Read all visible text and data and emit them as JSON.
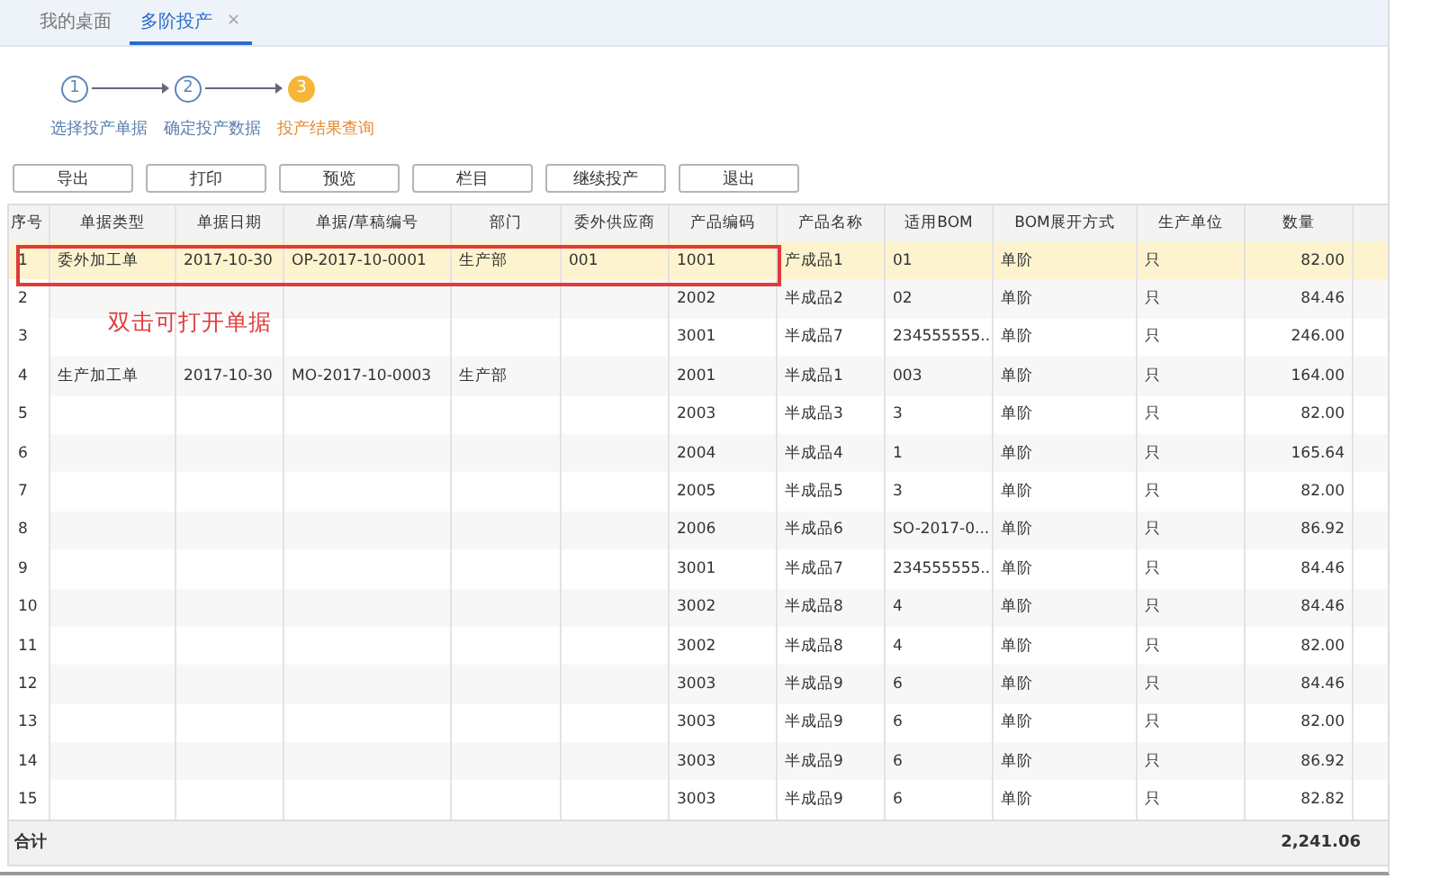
{
  "tabs": [
    {
      "label": "我的桌面",
      "selected": false
    },
    {
      "label": "多阶投产",
      "selected": true,
      "close": "✕"
    }
  ],
  "steps": [
    {
      "number": "1",
      "label": "选择投产单据",
      "current": false
    },
    {
      "number": "2",
      "label": "确定投产数据",
      "current": false
    },
    {
      "number": "3",
      "label": "投产结果查询",
      "current": true
    }
  ],
  "toolbar": [
    "导出",
    "打印",
    "预览",
    "栏目",
    "继续投产",
    "退出"
  ],
  "table": {
    "columns": [
      "序号",
      "单据类型",
      "单据日期",
      "单据/草稿编号",
      "部门",
      "委外供应商",
      "产品编码",
      "产品名称",
      "适用BOM",
      "BOM展开方式",
      "生产单位",
      "数量"
    ],
    "rows": [
      {
        "selected": true,
        "cells": [
          "1",
          "委外加工单",
          "2017-10-30",
          "OP-2017-10-0001",
          "生产部",
          "001",
          "1001",
          "产成品1",
          "01",
          "单阶",
          "只",
          "82.00"
        ]
      },
      {
        "selected": false,
        "cells": [
          "2",
          "",
          "",
          "",
          "",
          "",
          "2002",
          "半成品2",
          "02",
          "单阶",
          "只",
          "84.46"
        ]
      },
      {
        "selected": false,
        "cells": [
          "3",
          "",
          "",
          "",
          "",
          "",
          "3001",
          "半成品7",
          "234555555...",
          "单阶",
          "只",
          "246.00"
        ]
      },
      {
        "selected": false,
        "cells": [
          "4",
          "生产加工单",
          "2017-10-30",
          "MO-2017-10-0003",
          "生产部",
          "",
          "2001",
          "半成品1",
          "003",
          "单阶",
          "只",
          "164.00"
        ]
      },
      {
        "selected": false,
        "cells": [
          "5",
          "",
          "",
          "",
          "",
          "",
          "2003",
          "半成品3",
          "3",
          "单阶",
          "只",
          "82.00"
        ]
      },
      {
        "selected": false,
        "cells": [
          "6",
          "",
          "",
          "",
          "",
          "",
          "2004",
          "半成品4",
          "1",
          "单阶",
          "只",
          "165.64"
        ]
      },
      {
        "selected": false,
        "cells": [
          "7",
          "",
          "",
          "",
          "",
          "",
          "2005",
          "半成品5",
          "3",
          "单阶",
          "只",
          "82.00"
        ]
      },
      {
        "selected": false,
        "cells": [
          "8",
          "",
          "",
          "",
          "",
          "",
          "2006",
          "半成品6",
          "SO-2017-0...",
          "单阶",
          "只",
          "86.92"
        ]
      },
      {
        "selected": false,
        "cells": [
          "9",
          "",
          "",
          "",
          "",
          "",
          "3001",
          "半成品7",
          "234555555...",
          "单阶",
          "只",
          "84.46"
        ]
      },
      {
        "selected": false,
        "cells": [
          "10",
          "",
          "",
          "",
          "",
          "",
          "3002",
          "半成品8",
          "4",
          "单阶",
          "只",
          "84.46"
        ]
      },
      {
        "selected": false,
        "cells": [
          "11",
          "",
          "",
          "",
          "",
          "",
          "3002",
          "半成品8",
          "4",
          "单阶",
          "只",
          "82.00"
        ]
      },
      {
        "selected": false,
        "cells": [
          "12",
          "",
          "",
          "",
          "",
          "",
          "3003",
          "半成品9",
          "6",
          "单阶",
          "只",
          "84.46"
        ]
      },
      {
        "selected": false,
        "cells": [
          "13",
          "",
          "",
          "",
          "",
          "",
          "3003",
          "半成品9",
          "6",
          "单阶",
          "只",
          "82.00"
        ]
      },
      {
        "selected": false,
        "cells": [
          "14",
          "",
          "",
          "",
          "",
          "",
          "3003",
          "半成品9",
          "6",
          "单阶",
          "只",
          "86.92"
        ]
      },
      {
        "selected": false,
        "cells": [
          "15",
          "",
          "",
          "",
          "",
          "",
          "3003",
          "半成品9",
          "6",
          "单阶",
          "只",
          "82.82"
        ]
      }
    ],
    "footer": {
      "label": "合计",
      "total": "2,241.06"
    }
  },
  "annotation": {
    "text": "双击可打开单据",
    "color": "#e03b3b"
  }
}
